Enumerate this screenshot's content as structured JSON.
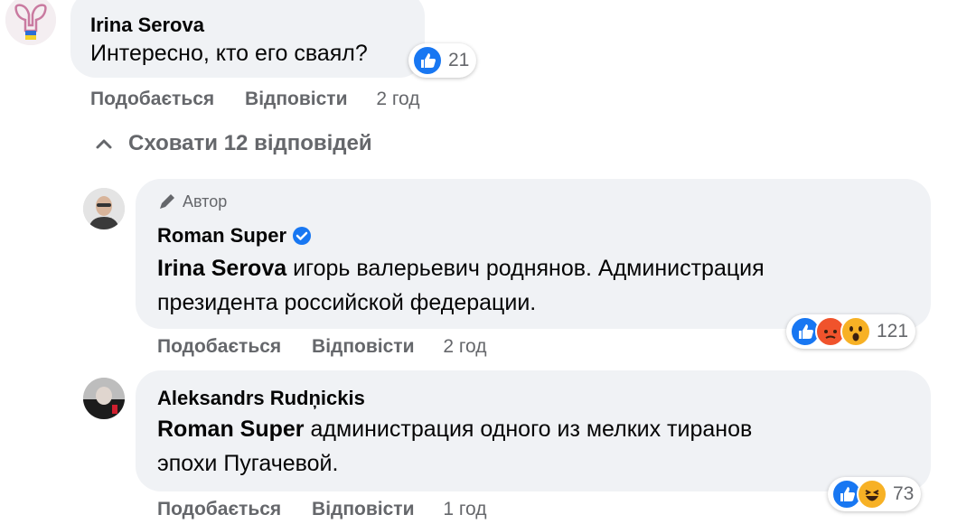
{
  "colors": {
    "like": "#1877f2",
    "bubble": "#f0f2f5",
    "meta": "#65676b",
    "angry": "#f0532c",
    "wow": "#f7b125",
    "verified": "#1877f2"
  },
  "comments": [
    {
      "author": "Irina Serova",
      "text": "Интересно, кто его сваял?",
      "reactions": {
        "icons": [
          "like-icon"
        ],
        "count": "21"
      },
      "actions": {
        "like": "Подобається",
        "reply": "Відповісти",
        "time": "2 год"
      }
    },
    {
      "badge": "Автор",
      "author": "Roman Super",
      "mention": "Irina Serova",
      "text_line1": " игорь валерьевич роднянов. Администрация",
      "text_line2": "президента российской федерации.",
      "reactions": {
        "icons": [
          "like-icon",
          "angry-icon",
          "wow-icon"
        ],
        "count": "121"
      },
      "actions": {
        "like": "Подобається",
        "reply": "Відповісти",
        "time": "2 год"
      }
    },
    {
      "author": "Aleksandrs Rudņickis",
      "mention": "Roman Super",
      "text_line1": " администрация одного из мелких тиранов",
      "text_line2": "эпохи Пугачевой.",
      "reactions": {
        "icons": [
          "like-icon",
          "haha-icon"
        ],
        "count": "73"
      },
      "actions": {
        "like": "Подобається",
        "reply": "Відповісти",
        "time": "1 год"
      }
    }
  ],
  "replies_toggle": {
    "icon": "chevron-up-icon",
    "label": "Сховати 12 відповідей"
  }
}
